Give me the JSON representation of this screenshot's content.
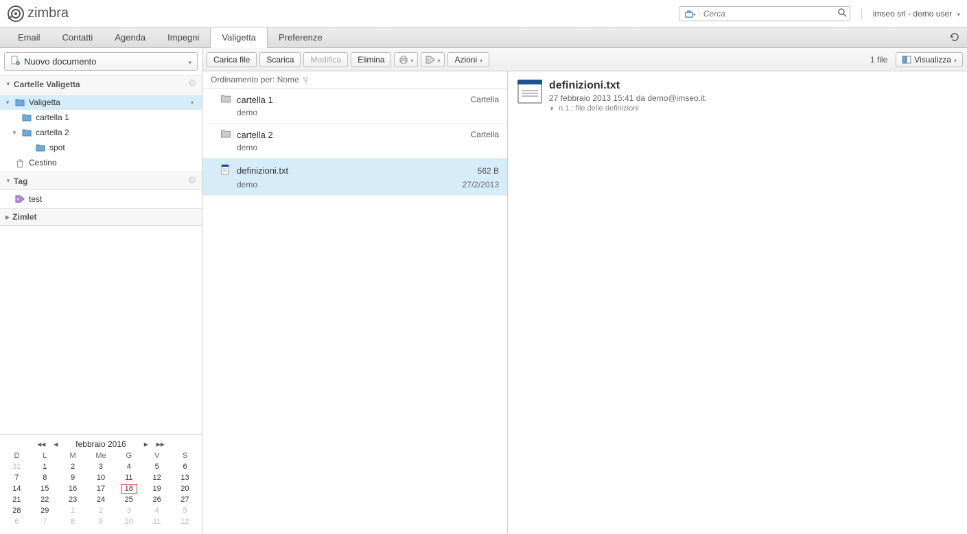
{
  "brand": "zimbra",
  "search": {
    "placeholder": "Cerca"
  },
  "user_menu": "imseo srl - demo user",
  "tabs": {
    "email": "Email",
    "contatti": "Contatti",
    "agenda": "Agenda",
    "impegni": "Impegni",
    "valigetta": "Valigetta",
    "preferenze": "Preferenze"
  },
  "sidebar": {
    "new_doc": "Nuovo documento",
    "sections": {
      "folders": "Cartelle Valigetta",
      "tags": "Tag",
      "zimlet": "Zimlet"
    },
    "tree": {
      "valigetta": "Valigetta",
      "cartella1": "cartella 1",
      "cartella2": "cartella 2",
      "spot": "spot",
      "cestino": "Cestino"
    },
    "tags": {
      "test": "test"
    }
  },
  "calendar": {
    "title": "febbraio 2016",
    "days": [
      "D",
      "L",
      "M",
      "Me",
      "G",
      "V",
      "S"
    ],
    "weeks": [
      [
        {
          "d": "31",
          "o": true
        },
        {
          "d": "1"
        },
        {
          "d": "2"
        },
        {
          "d": "3"
        },
        {
          "d": "4"
        },
        {
          "d": "5"
        },
        {
          "d": "6"
        }
      ],
      [
        {
          "d": "7"
        },
        {
          "d": "8"
        },
        {
          "d": "9"
        },
        {
          "d": "10"
        },
        {
          "d": "11"
        },
        {
          "d": "12"
        },
        {
          "d": "13"
        }
      ],
      [
        {
          "d": "14"
        },
        {
          "d": "15"
        },
        {
          "d": "16"
        },
        {
          "d": "17"
        },
        {
          "d": "18",
          "t": true
        },
        {
          "d": "19"
        },
        {
          "d": "20"
        }
      ],
      [
        {
          "d": "21"
        },
        {
          "d": "22"
        },
        {
          "d": "23"
        },
        {
          "d": "24"
        },
        {
          "d": "25"
        },
        {
          "d": "26"
        },
        {
          "d": "27"
        }
      ],
      [
        {
          "d": "28"
        },
        {
          "d": "29"
        },
        {
          "d": "1",
          "o": true
        },
        {
          "d": "2",
          "o": true
        },
        {
          "d": "3",
          "o": true
        },
        {
          "d": "4",
          "o": true
        },
        {
          "d": "5",
          "o": true
        }
      ],
      [
        {
          "d": "6",
          "o": true
        },
        {
          "d": "7",
          "o": true
        },
        {
          "d": "8",
          "o": true
        },
        {
          "d": "9",
          "o": true
        },
        {
          "d": "10",
          "o": true
        },
        {
          "d": "11",
          "o": true
        },
        {
          "d": "12",
          "o": true
        }
      ]
    ]
  },
  "toolbar": {
    "carica": "Carica file",
    "scarica": "Scarica",
    "modifica": "Modifica",
    "elimina": "Elimina",
    "azioni": "Azioni",
    "filecount": "1 file",
    "visualizza": "Visualizza"
  },
  "list": {
    "sort_label": "Ordinamento per: Nome",
    "items": [
      {
        "icon": "folder",
        "name": "cartella 1",
        "meta": "Cartella",
        "author": "demo",
        "date": ""
      },
      {
        "icon": "folder",
        "name": "cartella 2",
        "meta": "Cartella",
        "author": "demo",
        "date": ""
      },
      {
        "icon": "doc",
        "name": "definizioni.txt",
        "meta": "562 B",
        "author": "demo",
        "date": "27/2/2013",
        "selected": true
      }
    ]
  },
  "preview": {
    "title": "definizioni.txt",
    "sub": "27 febbraio 2013 15:41 da demo@imseo.it",
    "note": "n.1 : file delle definizioni"
  }
}
